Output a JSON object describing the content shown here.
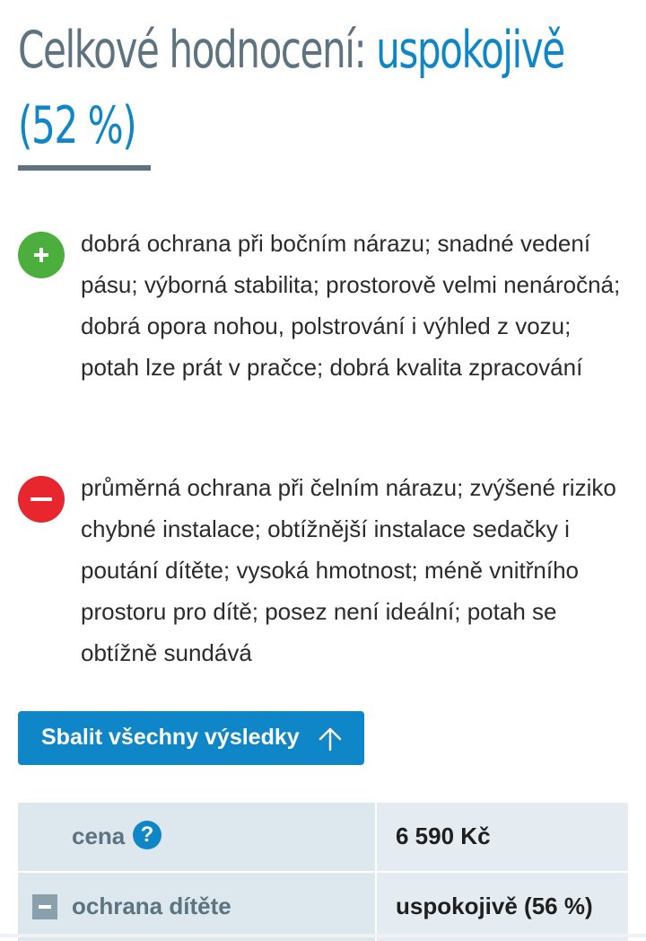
{
  "summary": {
    "label": "Celkové hodnocení:",
    "rating": "uspokojivě",
    "percent": "(52 %)"
  },
  "pros": {
    "icon": "plus-icon",
    "color": "#4cae3d",
    "text": "dobrá ochrana při bočním nárazu; snadné vedení pásu; výborná stabilita; prostorově velmi nenáročná; dobrá opora nohou, polstrování i výhled z vozu; potah lze prát v pračce; dobrá kvalita zpracování"
  },
  "cons": {
    "icon": "minus-icon",
    "color": "#e8262e",
    "text": "průměrná ochrana při čelním nárazu; zvýšené riziko chybné instalace; obtížnější instalace sedačky i poutání dítěte; vysoká hmotnost; méně vnitřního prostoru pro dítě; posez není ideální; potah se obtížně sundává"
  },
  "collapse_button": {
    "label": "Sbalit všechny výsledky",
    "icon": "arrow-up-icon",
    "color": "#0f86c8"
  },
  "results": [
    {
      "name": "cena",
      "value": "6 590 Kč",
      "icon": "help-icon",
      "icon_text": "?"
    },
    {
      "name": "ochrana dítěte",
      "value": "uspokojivě (56 %)",
      "icon": "collapse-icon"
    }
  ]
}
